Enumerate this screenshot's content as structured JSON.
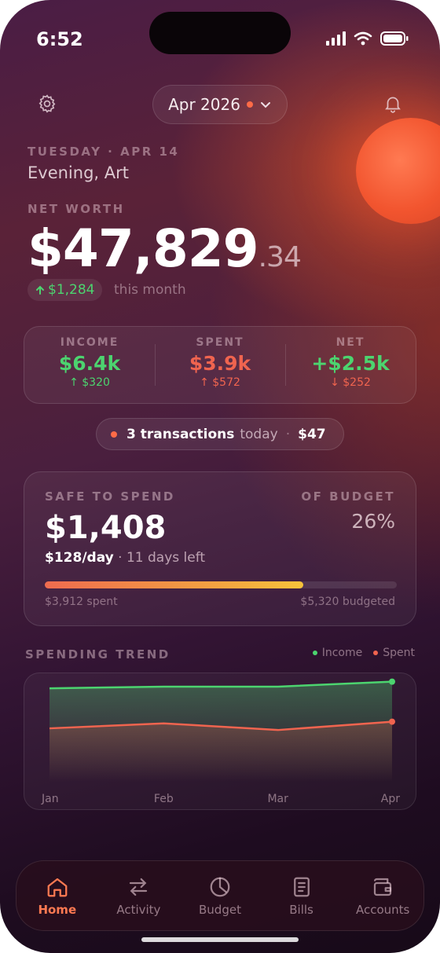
{
  "status": {
    "time": "6:52"
  },
  "header": {
    "month_label": "Apr 2026",
    "settings_icon": "gear-icon",
    "notifications_icon": "bell-icon"
  },
  "overview": {
    "date": "TUESDAY · APR 14",
    "greeting": "Evening, Art",
    "networth_label": "NET WORTH",
    "networth_whole": "$47,829",
    "networth_cents": ".34",
    "change_amount": "$1,284",
    "change_period": "this month"
  },
  "stats": [
    {
      "label": "INCOME",
      "value": "$6.4k",
      "delta": "↑ $320",
      "tone": "green"
    },
    {
      "label": "SPENT",
      "value": "$3.9k",
      "delta": "↑ $572",
      "tone": "red"
    },
    {
      "label": "NET",
      "value": "+$2.5k",
      "delta": "↓ $252",
      "tone": "mixed"
    }
  ],
  "transactions": {
    "count_text": "3 transactions",
    "suffix": "today",
    "separator": "·",
    "amount": "$47"
  },
  "safe_to_spend": {
    "label": "SAFE TO SPEND",
    "budget_label": "OF BUDGET",
    "amount": "$1,408",
    "percent": "26%",
    "per_day": "$128/day",
    "days_left": "· 11 days left",
    "progress_fraction": 0.735,
    "spent_text": "$3,912 spent",
    "budgeted_text": "$5,320 budgeted"
  },
  "trend": {
    "title": "SPENDING TREND",
    "legend_income": "Income",
    "legend_spent": "Spent",
    "colors": {
      "income": "#4cd46f",
      "spent": "#f0644f"
    }
  },
  "chart_data": {
    "type": "area",
    "categories": [
      "Jan",
      "Feb",
      "Mar",
      "Apr"
    ],
    "series": [
      {
        "name": "Income",
        "values": [
          5.6,
          5.7,
          5.7,
          6.0
        ]
      },
      {
        "name": "Spent",
        "values": [
          3.2,
          3.5,
          3.1,
          3.6
        ]
      }
    ],
    "ylim": [
      0,
      6.5
    ]
  },
  "tabs": [
    {
      "label": "Home",
      "icon": "home-icon",
      "active": true
    },
    {
      "label": "Activity",
      "icon": "swap-arrows-icon",
      "active": false
    },
    {
      "label": "Budget",
      "icon": "pie-clock-icon",
      "active": false
    },
    {
      "label": "Bills",
      "icon": "document-icon",
      "active": false
    },
    {
      "label": "Accounts",
      "icon": "wallet-icon",
      "active": false
    }
  ]
}
